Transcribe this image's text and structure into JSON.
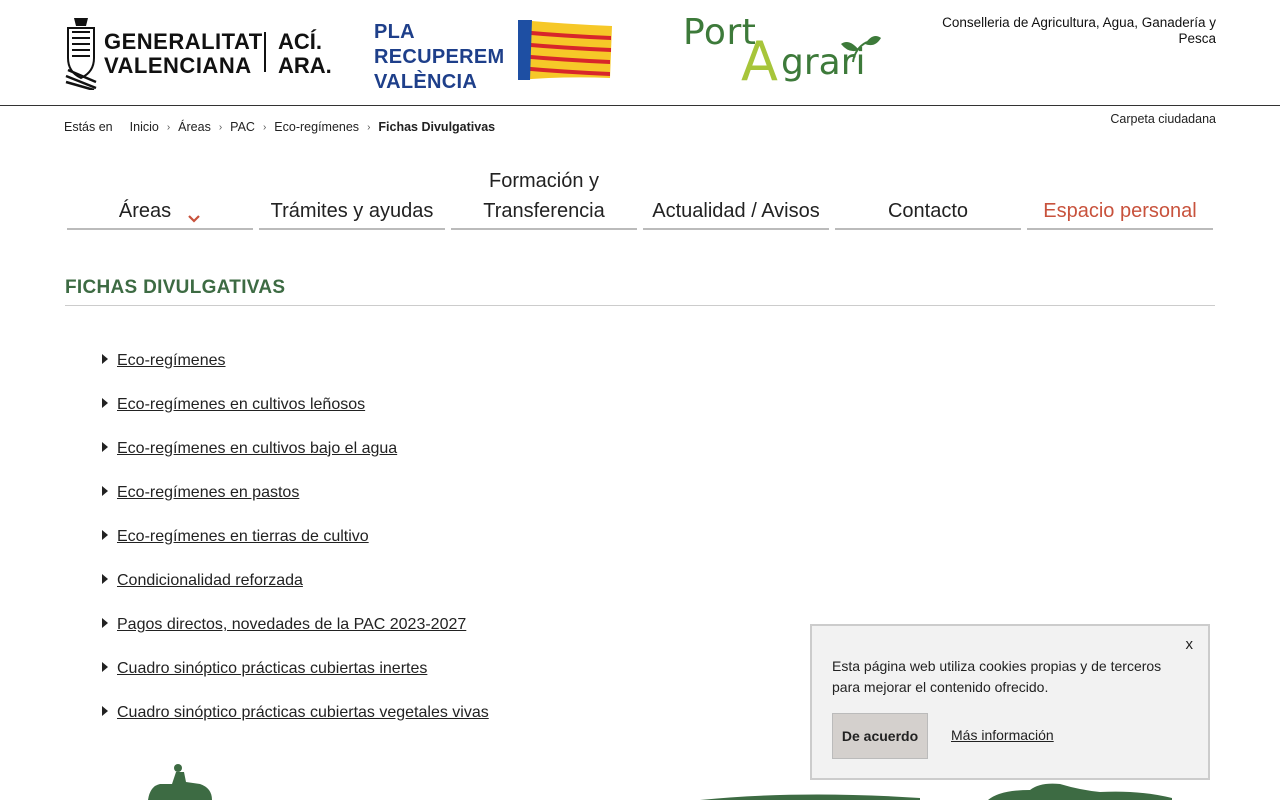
{
  "header": {
    "gv_logo": {
      "line1": "GENERALITAT",
      "line2": "VALENCIANA",
      "aci": "ACÍ.",
      "ara": "ARA."
    },
    "pla_logo": {
      "line1": "PLA",
      "line2": "RECUPEREM",
      "line3": "VALÈNCIA"
    },
    "portal_logo": {
      "port": "Port",
      "a": "A",
      "grari": "grari"
    },
    "conselleria": "Conselleria de Agricultura, Agua, Ganadería y Pesca"
  },
  "breadcrumb": {
    "label": "Estás en",
    "items": [
      "Inicio",
      "Áreas",
      "PAC",
      "Eco-regímenes"
    ],
    "current": "Fichas Divulgativas"
  },
  "carpeta": "Carpeta ciudadana",
  "nav": {
    "items": [
      "Áreas",
      "Trámites y ayudas",
      "Formación y Transferencia",
      "Actualidad / Avisos",
      "Contacto",
      "Espacio personal"
    ]
  },
  "section": {
    "title": "FICHAS DIVULGATIVAS",
    "links": [
      "Eco-regímenes",
      "Eco-regímenes en cultivos leñosos",
      "Eco-regímenes en cultivos bajo el agua",
      "Eco-regímenes en pastos",
      "Eco-regímenes en tierras de cultivo",
      "Condicionalidad reforzada",
      "Pagos directos, novedades de la PAC 2023-2027",
      "Cuadro sinóptico prácticas cubiertas inertes",
      "Cuadro sinóptico prácticas cubiertas vegetales vivas"
    ]
  },
  "cookie": {
    "close": "x",
    "text": "Esta página web utiliza cookies propias y de terceros para mejorar el contenido ofrecido.",
    "accept": "De acuerdo",
    "more": "Más información"
  },
  "colors": {
    "brand_green": "#3d6b43",
    "accent_red": "#c8523c",
    "portal_lime": "#a7c53a"
  },
  "icons": [
    "gv-shield-icon",
    "senyera-flag-icon",
    "leaf-icon",
    "chevron-right-icon",
    "chevron-down-icon",
    "caret-right-icon",
    "close-icon"
  ]
}
